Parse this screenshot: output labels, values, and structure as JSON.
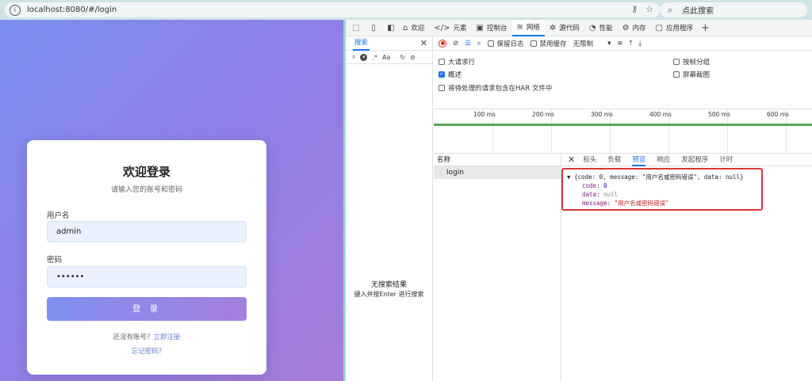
{
  "browser": {
    "url": "localhost:8080/#/login",
    "search_placeholder": "点此搜索"
  },
  "login": {
    "title": "欢迎登录",
    "subtitle": "请输入您的账号和密码",
    "username_label": "用户名",
    "username_value": "admin",
    "password_label": "密码",
    "password_value": "••••••",
    "submit_label": "登 录",
    "register_prompt": "还没有账号？",
    "register_link": "立即注册",
    "forgot_link": "忘记密码?"
  },
  "devtools": {
    "tabs": [
      {
        "label": "欢迎",
        "icon": "home-icon"
      },
      {
        "label": "元素",
        "icon": "code-icon"
      },
      {
        "label": "控制台",
        "icon": "console-icon"
      },
      {
        "label": "网络",
        "icon": "wifi-icon",
        "active": true
      },
      {
        "label": "源代码",
        "icon": "bug-icon"
      },
      {
        "label": "性能",
        "icon": "gauge-icon"
      },
      {
        "label": "内存",
        "icon": "memory-icon"
      },
      {
        "label": "应用程序",
        "icon": "app-icon"
      }
    ],
    "search_panel": {
      "tab_label": "搜索",
      "case_label": "Aa",
      "regex_label": ".*",
      "empty_title": "无搜索结果",
      "empty_hint": "键入并按Enter 进行搜索"
    },
    "network": {
      "preserve_log": "保留日志",
      "disable_cache": "禁用缓存",
      "throttling": "无限制",
      "options": {
        "large_rows": "大请求行",
        "overview": "概述",
        "har_option": "将待处理的请求包含在HAR 文件中",
        "group_by_frame": "按帧分组",
        "screenshots": "屏幕截图"
      },
      "overview_checked": true,
      "ticks": [
        "100 ms",
        "200 ms",
        "300 ms",
        "400 ms",
        "500 ms",
        "600 ms"
      ],
      "name_header": "名称",
      "request_name": "login",
      "detail_tabs": [
        "标头",
        "负载",
        "预览",
        "响应",
        "发起程序",
        "计时"
      ],
      "active_detail_tab": "预览",
      "preview": {
        "summary": "{code: 0, message: \"用户名或密码错误\", data: null}",
        "code_key": "code",
        "code_value": "0",
        "data_key": "data",
        "data_value": "null",
        "message_key": "message",
        "message_value": "\"用户名或密码错误\""
      }
    }
  },
  "colors": {
    "accent": "#1a73e8",
    "highlight_border": "#d93436",
    "gradient_start": "#7c8ef0",
    "gradient_end": "#a67cd8"
  }
}
